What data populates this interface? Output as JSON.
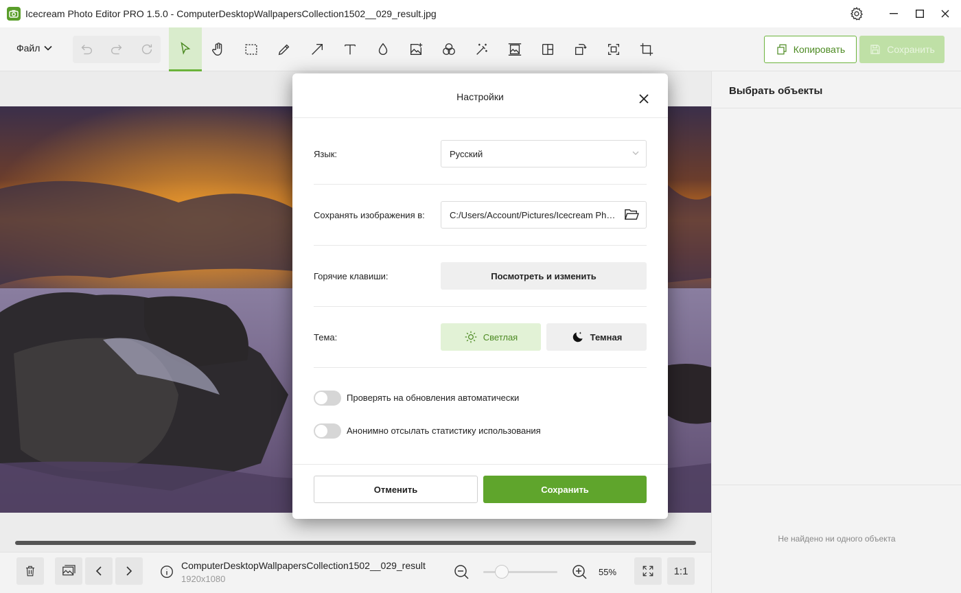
{
  "window": {
    "title": "Icecream Photo Editor PRO 1.5.0 - ComputerDesktopWallpapersCollection1502__029_result.jpg"
  },
  "toolbar": {
    "file_menu": "Файл",
    "copy_label": "Копировать",
    "save_label": "Сохранить"
  },
  "right_panel": {
    "title": "Выбрать объекты",
    "empty_text": "Не найдено ни одного объекта"
  },
  "bottom_bar": {
    "file_name": "ComputerDesktopWallpapersCollection1502__029_result",
    "dimensions": "1920x1080",
    "zoom": "55%",
    "zoom_fraction": 0.3,
    "actual_size_label": "1:1"
  },
  "settings": {
    "title": "Настройки",
    "language_label": "Язык:",
    "language_value": "Русский",
    "save_path_label": "Сохранять изображения в:",
    "save_path_value": "C:/Users/Account/Pictures/Icecream Photo Editor",
    "hotkeys_label": "Горячие клавиши:",
    "hotkeys_button": "Посмотреть и изменить",
    "theme_label": "Тема:",
    "theme_light": "Светлая",
    "theme_dark": "Темная",
    "theme_selected": "light",
    "auto_update_label": "Проверять на обновления автоматически",
    "auto_update_on": false,
    "stats_label": "Анонимно отсылать статистику использования",
    "stats_on": false,
    "cancel_button": "Отменить",
    "save_button": "Сохранить"
  },
  "colors": {
    "accent": "#5fa52c",
    "accent_light": "#e2f2d6"
  }
}
